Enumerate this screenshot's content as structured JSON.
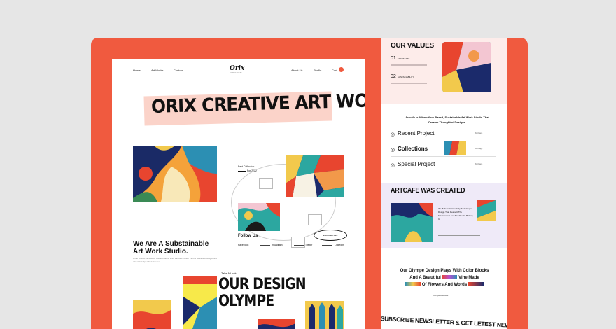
{
  "nav": {
    "links": [
      "Home",
      "Art Works",
      "Custom"
    ],
    "logo": "Orix",
    "logo_sub": "Art Work Studio",
    "right_links": [
      "About Us",
      "Profile"
    ],
    "cart": "Cart",
    "cart_count": "0"
  },
  "hero": {
    "banner": "ORIX CREATIVE ART WORK",
    "collection_label": "Best Collection",
    "collection_year": "For 2022",
    "explore_button": "EXPLORE ALL",
    "tagline": "We Are A Substainable Art Work Studio.",
    "tagline_sub": "What Over A Decade Of Collaborations With Famous Lorem Partner Standard Budget And Also Work Specified Renown."
  },
  "follow": {
    "title": "Follow Us",
    "links": [
      "Facebook",
      "Instagram",
      "Twitter",
      "LinkedIn"
    ]
  },
  "design": {
    "kicker": "Take A Look",
    "title_line1": "OUR DESIGN",
    "title_line2": "OLYMPE"
  },
  "values": {
    "title": "OUR VALUES",
    "items": [
      {
        "num": "01",
        "label": "CREATIVITY"
      },
      {
        "num": "02",
        "label": "SUSTAINABILITY"
      }
    ]
  },
  "intro": "Artcafe Is A New York Based, Sustainable Art Work Studio That Creates Thoughtful Designs.",
  "projects": [
    {
      "label": "Recent Project",
      "meta": "Visit Page"
    },
    {
      "label": "Collections",
      "meta": "Visit Page"
    },
    {
      "label": "Special Project",
      "meta": "Visit Page"
    }
  ],
  "created": {
    "title": "ARTCAFE WAS CREATED",
    "text": "We Believe In Creativity And Unique Design That Respect The Environment And The People Making It."
  },
  "olympe": {
    "line1": "Our Olympe Design Plays With Color Blocks",
    "line2a": "And A Beautiful",
    "line2b": "Vine Made",
    "line3": "Of Flowers And Words",
    "caption": "Olympe Arel Beit"
  },
  "newsletter": "SUBSCRIBE NEWSLETTER & GET LETEST NEWS",
  "colors": {
    "accent": "#f05a3f",
    "banner_bg": "#fbd3c9",
    "values_bg": "#fdecea",
    "created_bg": "#efeaf8"
  }
}
